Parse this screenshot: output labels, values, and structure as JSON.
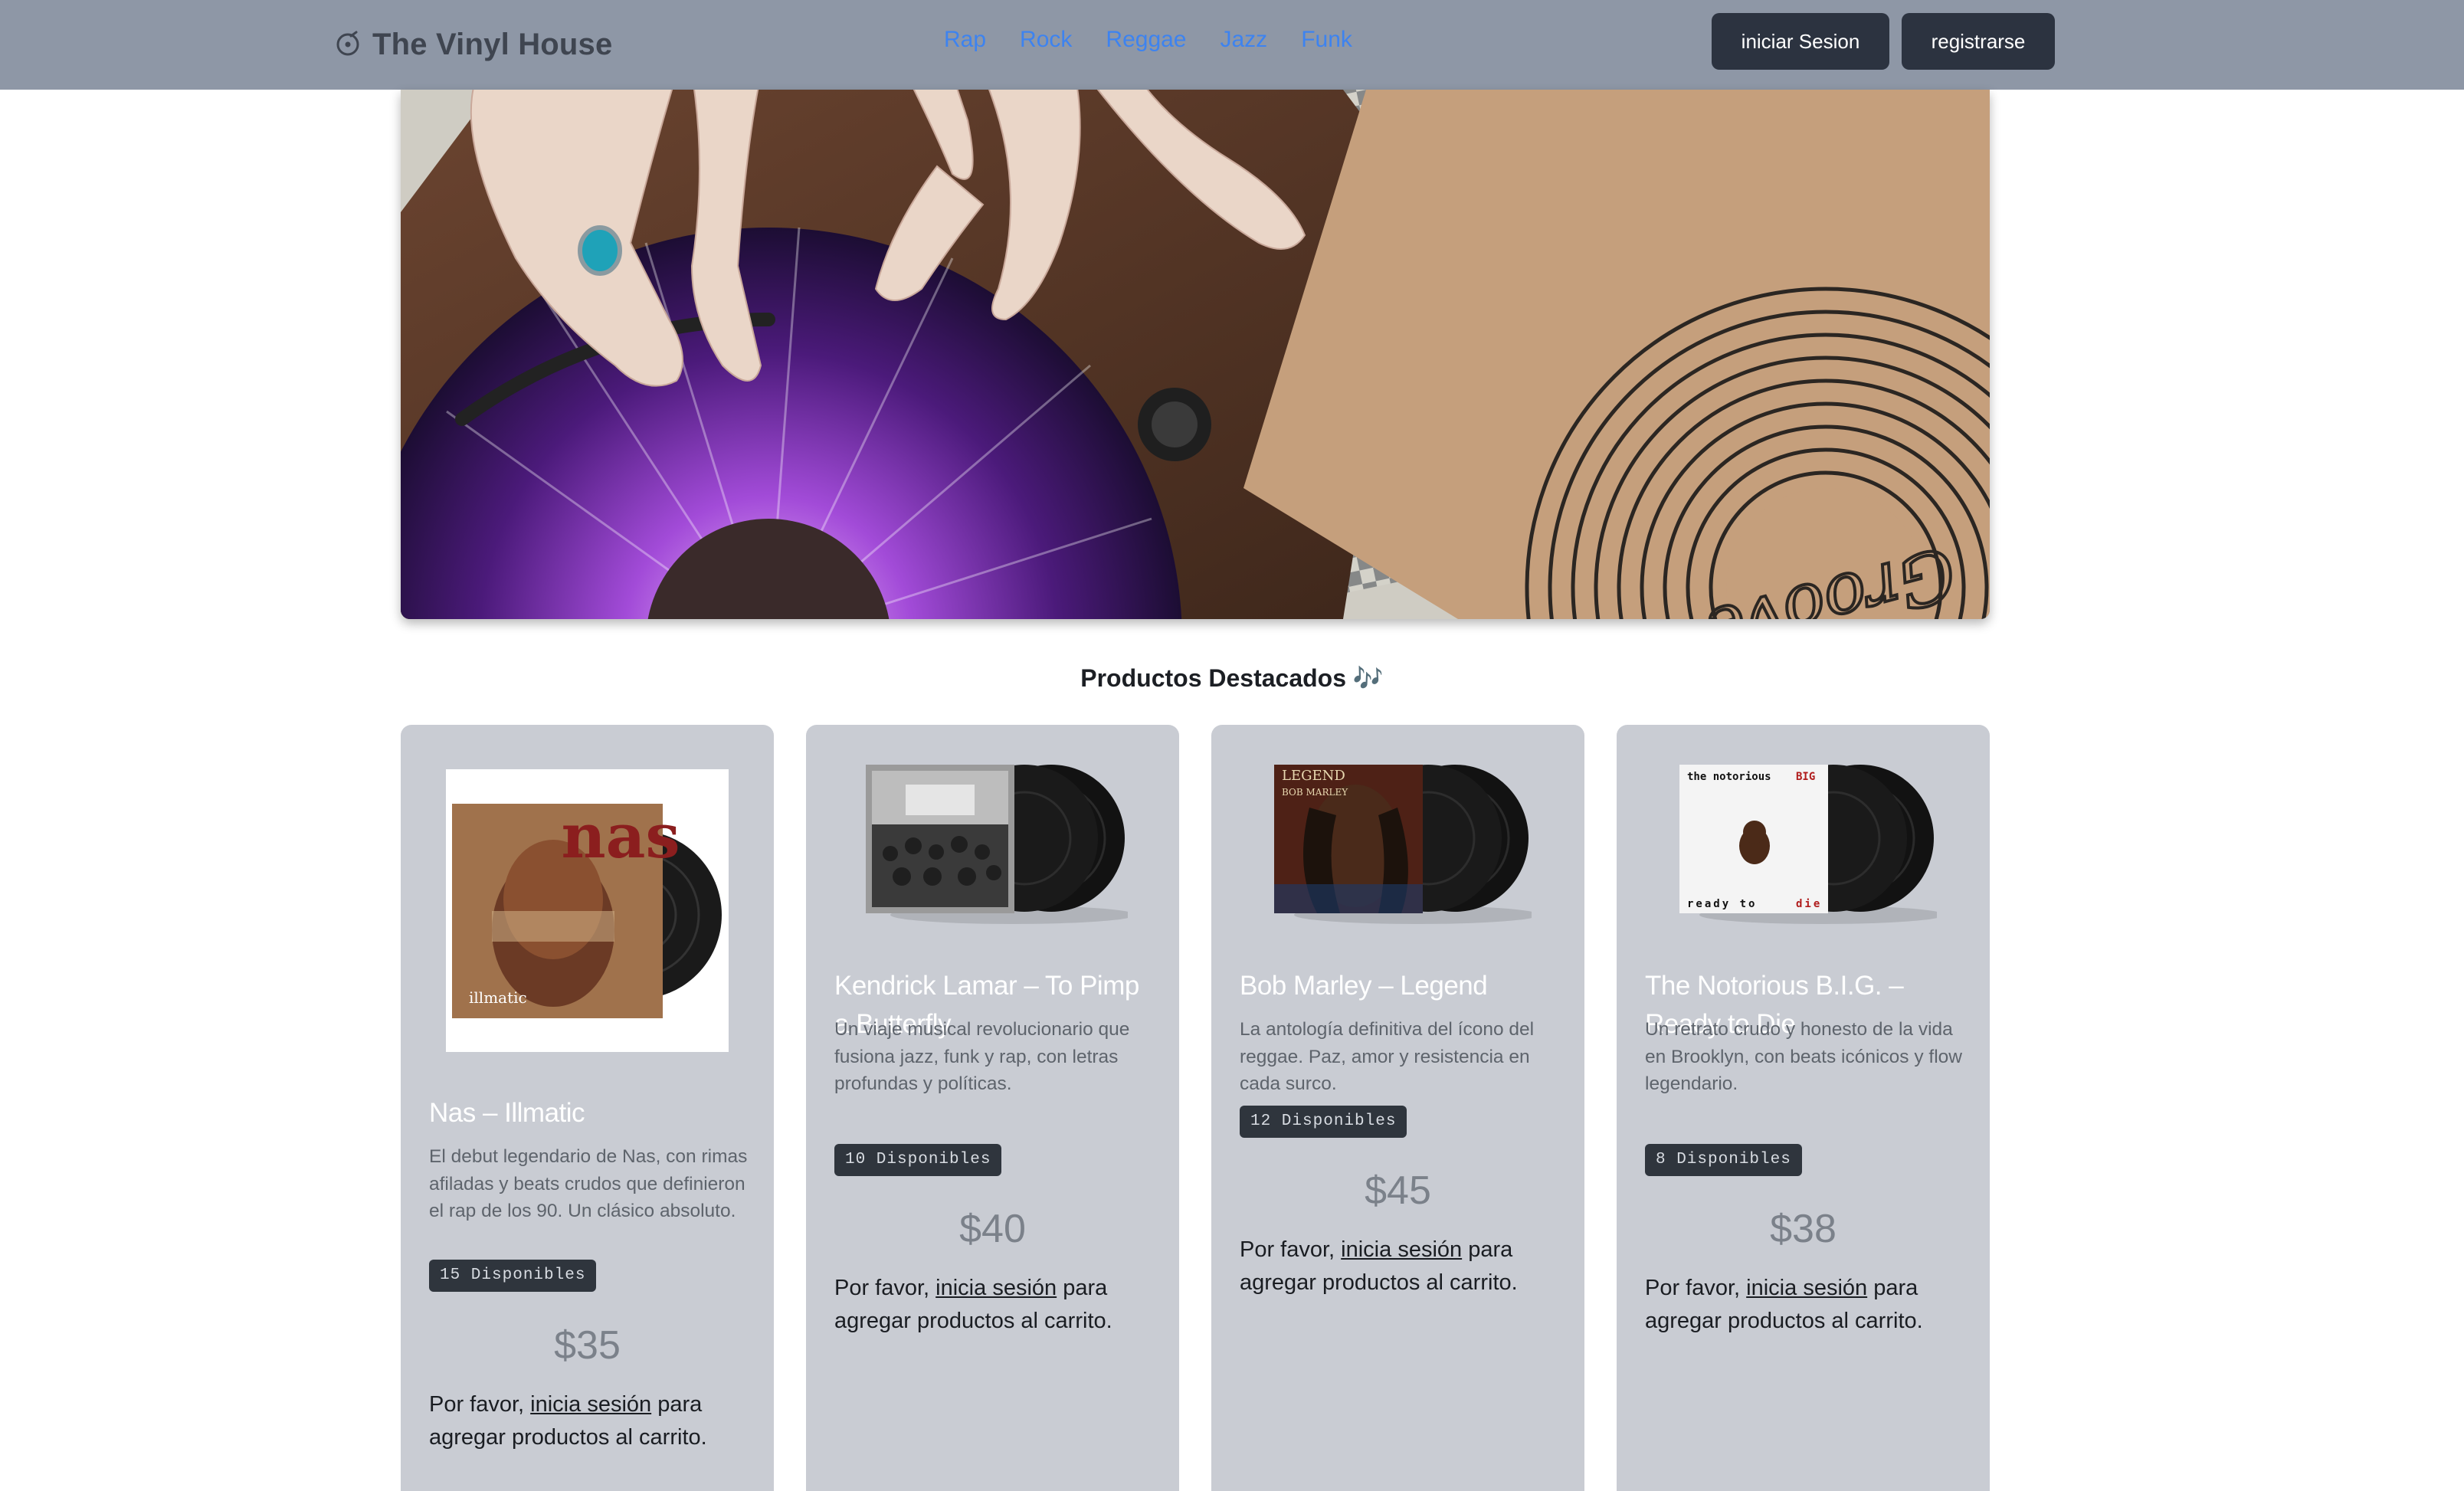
{
  "header": {
    "brand": "The Vinyl House",
    "brand_icon": "record-icon",
    "nav": [
      "Rap",
      "Rock",
      "Reggae",
      "Jazz",
      "Funk"
    ],
    "login_label": "iniciar Sesion",
    "register_label": "registrarse",
    "colors": {
      "bar": "#8e97a6",
      "link": "#3d83f0",
      "button": "#2c3340"
    }
  },
  "hero": {
    "alt": "Vinyl record on turntable",
    "sleeve_text": "Groove"
  },
  "section_title": "Productos Destacados 🎶",
  "products": [
    {
      "title": "Nas – Illmatic",
      "description": "El debut legendario de Nas, con rimas afiladas y beats crudos que definieron el rap de los 90. Un clásico absoluto.",
      "stock_label": "15 Disponibles",
      "price": "$35",
      "cover_text": "nas",
      "cover_subtext": "illmatic"
    },
    {
      "title": "Kendrick Lamar – To Pimp a Butterfly",
      "description": "Un viaje musical revolucionario que fusiona jazz, funk y rap, con letras profundas y políticas.",
      "stock_label": "10 Disponibles",
      "price": "$40"
    },
    {
      "title": "Bob Marley – Legend",
      "description": "La antología definitiva del ícono del reggae. Paz, amor y resistencia en cada surco.",
      "stock_label": "12 Disponibles",
      "price": "$45",
      "cover_text": "LEGEND",
      "cover_subtext": "BOB MARLEY"
    },
    {
      "title": "The Notorious B.I.G. – Ready to Die",
      "description": "Un retrato crudo y honesto de la vida en Brooklyn, con beats icónicos y flow legendario.",
      "stock_label": "8 Disponibles",
      "price": "$38",
      "cover_text_1": "the notorious",
      "cover_text_2": "BIG",
      "cover_text_3": "ready to",
      "cover_text_4": "die"
    }
  ],
  "login_note": {
    "before": "Por favor, ",
    "link": "inicia sesión",
    "after": " para agregar productos al carrito."
  }
}
